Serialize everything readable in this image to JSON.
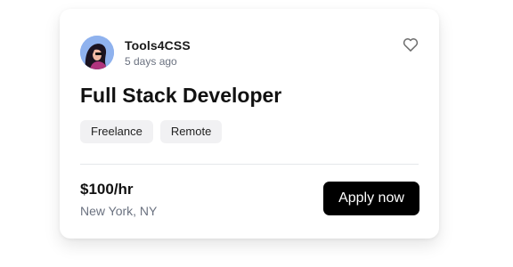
{
  "card": {
    "company": "Tools4CSS",
    "posted": "5 days ago",
    "title": "Full Stack Developer",
    "tags": [
      "Freelance",
      "Remote"
    ],
    "rate": "$100/hr",
    "location": "New York, NY",
    "apply_label": "Apply now",
    "icons": {
      "avatar": "avatar-illustration",
      "favorite": "heart-outline-icon"
    }
  },
  "colors": {
    "button_bg": "#000000",
    "button_text": "#ffffff",
    "tag_bg": "#f1f1f3",
    "muted_text": "#6b7280",
    "avatar_bg": "#8fb2ee"
  }
}
